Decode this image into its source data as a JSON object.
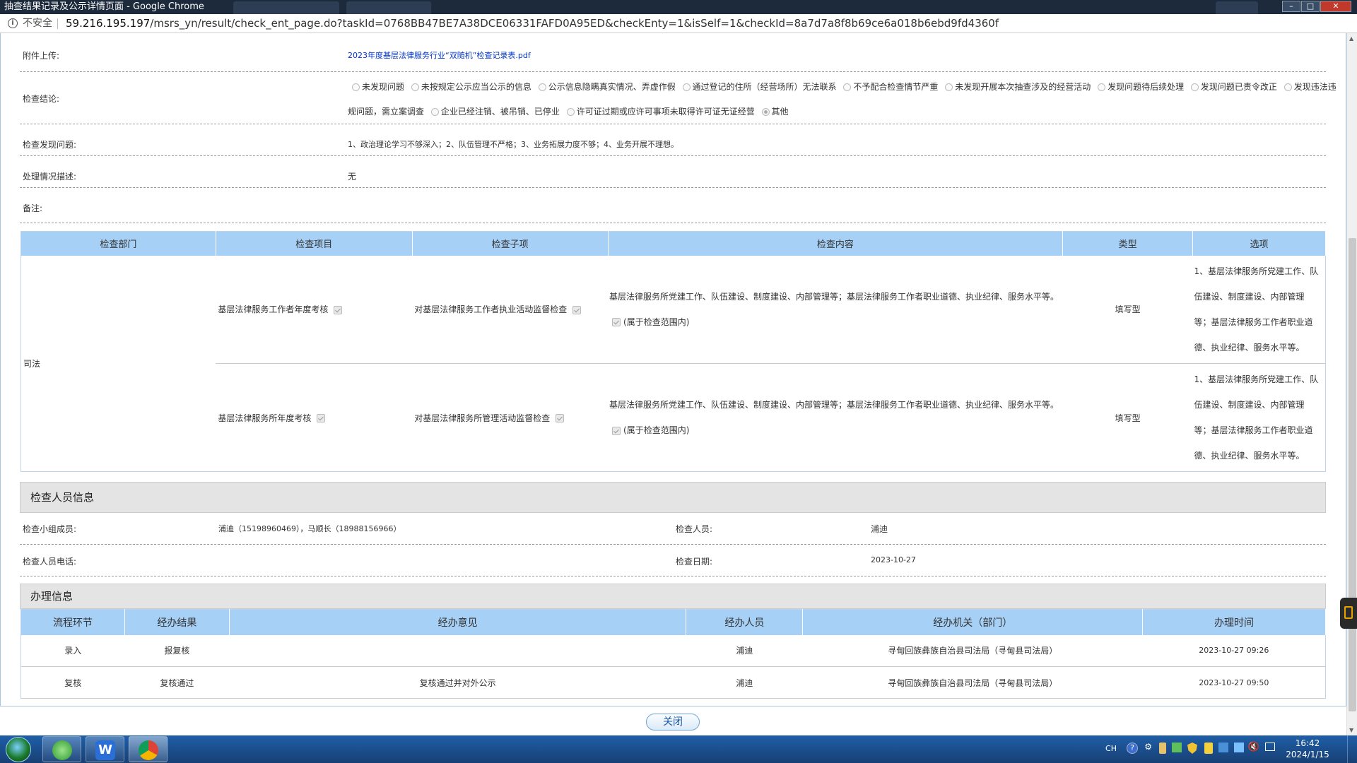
{
  "window": {
    "title": "抽查结果记录及公示详情页面 - Google Chrome"
  },
  "address_bar": {
    "security_label": "不安全",
    "url_host": "59.216.195.197",
    "url_path": "/msrs_yn/result/check_ent_page.do?taskId=0768BB47BE7A38DCE06331FAFD0A95ED&checkEnty=1&isSelf=1&checkId=8a7d7a8f8b69ce6a018b6ebd9fd4360f"
  },
  "form": {
    "attachment_label": "附件上传:",
    "attachment_file": "2023年度基层法律服务行业“双随机”检查记录表.pdf",
    "conclusion_label": "检查结论:",
    "conclusion_options": [
      "未发现问题",
      "未按规定公示应当公示的信息",
      "公示信息隐瞒真实情况、弄虚作假",
      "通过登记的住所（经营场所）无法联系",
      "不予配合检查情节严重",
      "未发现开展本次抽查涉及的经营活动",
      "发现问题待后续处理",
      "发现问题已责令改正",
      "发现违法违规问题，需立案调查",
      "企业已经注销、被吊销、已停业",
      "许可证过期或应许可事项未取得许可证无证经营",
      "其他"
    ],
    "conclusion_line1": [
      "未发现问题",
      "未按规定公示应当公示的信息",
      "公示信息隐瞒真实情况、弄虚作假",
      "通过登记的住所（经营场所）无法联系",
      "不予配合检查情节严重",
      "未发现开展本次抽查涉及的经营活动",
      "发现问题待后续处理",
      "发现问题已责令改正",
      "发现违法违"
    ],
    "conclusion_line2_prefix": "规问题，需立案调查",
    "conclusion_line2": [
      "企业已经注销、被吊销、已停业",
      "许可证过期或应许可事项未取得许可证无证经营",
      "其他"
    ],
    "conclusion_selected": "其他",
    "issues_label": "检查发现问题:",
    "issues_value": "1、政治理论学习不够深入；2、队伍管理不严格；3、业务拓展力度不够；4、业务开展不理想。",
    "handling_label": "处理情况描述:",
    "handling_value": "无",
    "remark_label": "备注:",
    "remark_value": ""
  },
  "check_table": {
    "headers": [
      "检查部门",
      "检查项目",
      "检查子项",
      "检查内容",
      "类型",
      "选项"
    ],
    "department": "司法",
    "rows": [
      {
        "item": "基层法律服务工作者年度考核",
        "subitem": "对基层法律服务工作者执业活动监督检查",
        "content": "基层法律服务所党建工作、队伍建设、制度建设、内部管理等；基层法律服务工作者职业道德、执业纪律、服务水平等。",
        "in_scope": "(属于检查范围内)",
        "type": "填写型",
        "option_lines": [
          "1、基层法律服务所党建工作、队",
          "伍建设、制度建设、内部管理",
          "等；基层法律服务工作者职业道",
          "德、执业纪律、服务水平等。"
        ]
      },
      {
        "item": "基层法律服务所年度考核",
        "subitem": "对基层法律服务所管理活动监督检查",
        "content": "基层法律服务所党建工作、队伍建设、制度建设、内部管理等；基层法律服务工作者职业道德、执业纪律、服务水平等。",
        "in_scope": "(属于检查范围内)",
        "type": "填写型",
        "option_lines": [
          "1、基层法律服务所党建工作、队",
          "伍建设、制度建设、内部管理",
          "等；基层法律服务工作者职业道",
          "德、执业纪律、服务水平等。"
        ]
      }
    ]
  },
  "inspectors": {
    "section_title": "检查人员信息",
    "team_label": "检查小组成员:",
    "team_value": "浦迪（15198960469），马顺长（18988156966）",
    "inspector_label": "检查人员:",
    "inspector_value": "浦迪",
    "phone_label": "检查人员电话:",
    "phone_value": "",
    "date_label": "检查日期:",
    "date_value": "2023-10-27"
  },
  "processing": {
    "section_title": "办理信息",
    "headers": [
      "流程环节",
      "经办结果",
      "经办意见",
      "经办人员",
      "经办机关（部门）",
      "办理时间"
    ],
    "rows": [
      [
        "录入",
        "报复核",
        "",
        "浦迪",
        "寻甸回族彝族自治县司法局（寻甸县司法局）",
        "2023-10-27 09:26"
      ],
      [
        "复核",
        "复核通过",
        "复核通过并对外公示",
        "浦迪",
        "寻甸回族彝族自治县司法局（寻甸县司法局）",
        "2023-10-27 09:50"
      ]
    ]
  },
  "close_button": "关闭",
  "taskbar": {
    "lang": "CH",
    "time": "16:42",
    "date": "2024/1/15"
  }
}
